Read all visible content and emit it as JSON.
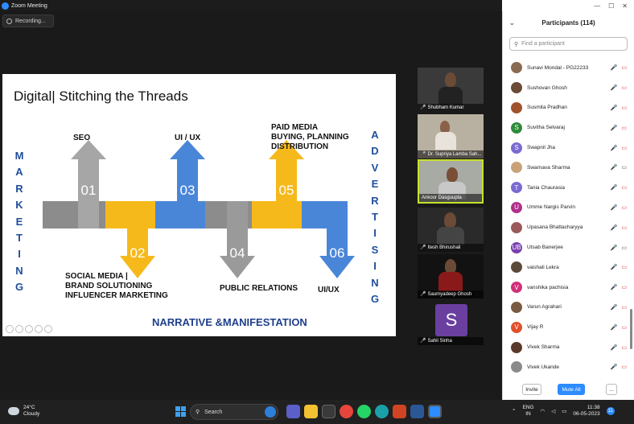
{
  "window": {
    "title": "Zoom Meeting"
  },
  "recording": {
    "label": "Recording..."
  },
  "slide": {
    "title": "Digital| Stitching the Threads",
    "left_word": [
      "M",
      "A",
      "R",
      "K",
      "E",
      "T",
      "I",
      "N",
      "G"
    ],
    "right_word": [
      "A",
      "D",
      "V",
      "E",
      "R",
      "T",
      "I",
      "S",
      "I",
      "N",
      "G"
    ],
    "steps": [
      {
        "num": "01",
        "label": "SEO",
        "color": "#a0a0a0"
      },
      {
        "num": "02",
        "label": "SOCIAL MEDIA |\nBRAND SOLUTIONING\nINFLUENCER MARKETING",
        "color": "#f6b91c"
      },
      {
        "num": "03",
        "label": "UI / UX",
        "color": "#4a86d8"
      },
      {
        "num": "04",
        "label": "PUBLIC RELATIONS",
        "color": "#9a9a9a"
      },
      {
        "num": "05",
        "label": "PAID MEDIA\nBUYING, PLANNING\nDISTRIBUTION",
        "color": "#f6b91c"
      },
      {
        "num": "06",
        "label": "UI/UX",
        "color": "#4a86d8"
      }
    ],
    "footer": "NARRATIVE &MANIFESTATION",
    "colors": {
      "gray": "#8c8c8c",
      "yellow": "#f6b91c",
      "blue": "#4a86d8",
      "navy": "#1f4e9c"
    }
  },
  "video_tiles": [
    {
      "name": "Shubham Kumar",
      "active": false
    },
    {
      "name": "Dr. Supriya Lamba Sah...",
      "active": false
    },
    {
      "name": "Ankoor Dasguupta",
      "active": true
    },
    {
      "name": "Itesh Bhirushali",
      "active": false
    },
    {
      "name": "Saumyadeep Ghosh",
      "active": false
    },
    {
      "name": "Sahil Sinha",
      "avatar": "S",
      "active": false
    }
  ],
  "participants": {
    "title": "Participants (114)",
    "search_placeholder": "Find a participant",
    "list": [
      {
        "name": "Sunavi Mondal - PG22233",
        "initial": "",
        "color": "#8a6a50",
        "cam": "off"
      },
      {
        "name": "Sushovan Ghosh",
        "initial": "",
        "color": "#6b4a36",
        "cam": "off"
      },
      {
        "name": "Susmita Pradhan",
        "initial": "",
        "color": "#a0522d",
        "cam": "off"
      },
      {
        "name": "Suvitha Selvaraj",
        "initial": "S",
        "color": "#2e8b3a",
        "cam": "off"
      },
      {
        "name": "Swapnil Jha",
        "initial": "S",
        "color": "#7a6ad0",
        "cam": "off"
      },
      {
        "name": "Swarnava Sharma",
        "initial": "",
        "color": "#c9a27a",
        "cam": "on"
      },
      {
        "name": "Tania Chaurasia",
        "initial": "T",
        "color": "#7a6ad0",
        "cam": "off"
      },
      {
        "name": "Umme Nargis Parvin",
        "initial": "U",
        "color": "#b0308a",
        "cam": "off"
      },
      {
        "name": "Upasana Bhattacharyya",
        "initial": "",
        "color": "#9a5a5a",
        "cam": "off"
      },
      {
        "name": "Utsab Banerjee",
        "initial": "UB",
        "color": "#7a3fb0",
        "cam": "on"
      },
      {
        "name": "vaishali Lekra",
        "initial": "",
        "color": "#5a4a3a",
        "cam": "off"
      },
      {
        "name": "vanshika pachisia",
        "initial": "V",
        "color": "#d0307a",
        "cam": "off"
      },
      {
        "name": "Varun Agrahari",
        "initial": "",
        "color": "#7a5a40",
        "cam": "off"
      },
      {
        "name": "Vijay R",
        "initial": "V",
        "color": "#e0502a",
        "cam": "off"
      },
      {
        "name": "Vivek Sharma",
        "initial": "",
        "color": "#5a3a2a",
        "cam": "off"
      },
      {
        "name": "Vivek Ukande",
        "initial": "",
        "color": "#8a8a8a",
        "cam": "off"
      }
    ],
    "invite_label": "Invite",
    "mute_all_label": "Mute All",
    "more_label": "..."
  },
  "taskbar": {
    "temp": "24°C",
    "weather": "Cloudy",
    "search_label": "Search",
    "lang_top": "ENG",
    "lang_bottom": "IN",
    "time": "11:38",
    "date": "06-05-2023",
    "notifications": "11"
  }
}
